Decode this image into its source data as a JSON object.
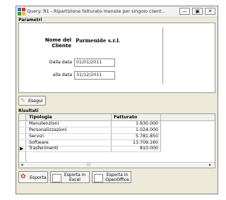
{
  "window": {
    "title": "Query: R1 - Ripartizione fatturato mensile per singolo client...",
    "minimize": "—",
    "maximize": "▣",
    "close": "✕"
  },
  "params": {
    "group_label": "Parametri",
    "cliente_label": "Nome del Cliente",
    "cliente_value": "Parmenide s.r.l.",
    "dalla_label": "Dalla data",
    "dalla_value": "01/01/2011",
    "alla_label": "alla data",
    "alla_value": "31/12/2011",
    "run_button": "Esegui"
  },
  "results": {
    "group_label": "Risultati",
    "columns": [
      "Tipologia",
      "Fatturato"
    ],
    "rows": [
      [
        "Manutenzioni",
        "1.930.000"
      ],
      [
        "Personalizzazioni",
        "1.024.000"
      ],
      [
        "Servizi",
        "5.781.850"
      ],
      [
        "Software",
        "13.709.160"
      ],
      [
        "Trasferimenti",
        "810.000"
      ]
    ],
    "current_row_marker": "▶",
    "scroll_left": "◂",
    "scroll_thumb": "|||",
    "scroll_right": "▸"
  },
  "toolbar": {
    "close_button": "Esporta",
    "excel_button": "Esporta in Excel",
    "openoffice_button": "Esporta in OpenOffice"
  },
  "colors": {
    "accent": "#316ac5",
    "window_bg": "#ece9d8"
  }
}
